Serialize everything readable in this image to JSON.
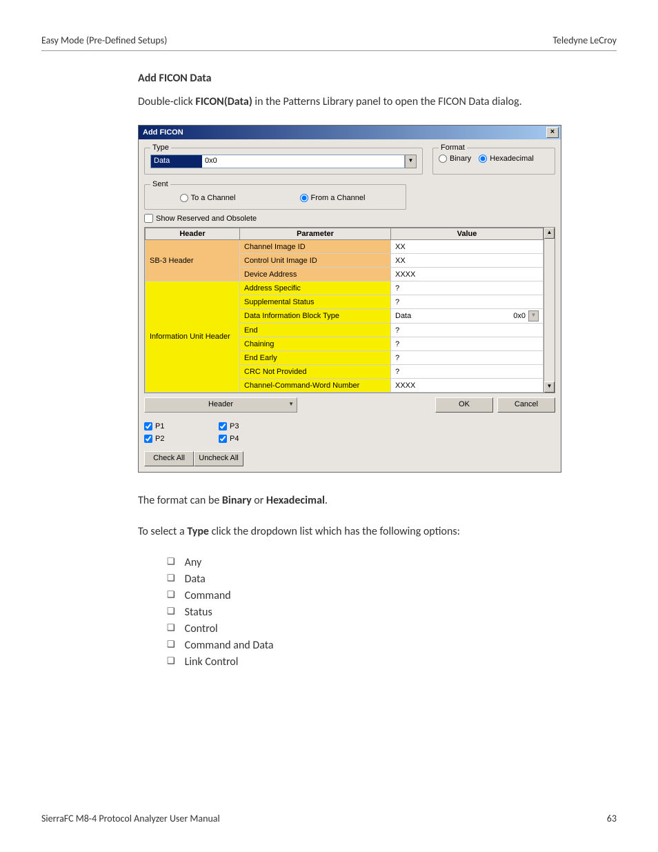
{
  "doc": {
    "header_left": "Easy Mode (Pre-Defined Setups)",
    "header_right": "Teledyne  LeCroy",
    "footer_left": "SierraFC M8-4 Protocol Analyzer User Manual",
    "footer_right": "63"
  },
  "section": {
    "heading": "Add FICON Data",
    "intro_pre": "Double-click ",
    "intro_bold": "FICON(Data)",
    "intro_post": " in the Patterns Library panel to open the FICON Data dialog.",
    "format_line_a": "The format can be ",
    "format_line_b": "Binary",
    "format_line_c": " or ",
    "format_line_d": "Hexadecimal",
    "format_line_e": ".",
    "type_line_a": "To select a ",
    "type_line_b": "Type",
    "type_line_c": " click the dropdown list which has the following options:",
    "options": [
      "Any",
      "Data",
      "Command",
      "Status",
      "Control",
      "Command and Data",
      "Link Control"
    ]
  },
  "dialog": {
    "title": "Add FICON",
    "type_legend": "Type",
    "type_value": "Data",
    "type_code": "0x0",
    "format_legend": "Format",
    "format_binary": "Binary",
    "format_hex": "Hexadecimal",
    "sent_legend": "Sent",
    "sent_to": "To a Channel",
    "sent_from": "From a Channel",
    "show_reserved": "Show Reserved and Obsolete",
    "col_header": "Header",
    "col_param": "Parameter",
    "col_value": "Value",
    "rows": {
      "g1": "SB-3 Header",
      "g2": "Information Unit Header",
      "r0p": "Channel Image ID",
      "r0v": "XX",
      "r1p": "Control Unit Image ID",
      "r1v": "XX",
      "r2p": "Device Address",
      "r2v": "XXXX",
      "r3p": "Address Specific",
      "r3v": "?",
      "r4p": "Supplemental Status",
      "r4v": "?",
      "r5p": "Data Information Block Type",
      "r5v_a": "Data",
      "r5v_b": "0x0",
      "r6p": "End",
      "r6v": "?",
      "r7p": "Chaining",
      "r7v": "?",
      "r8p": "End Early",
      "r8v": "?",
      "r9p": "CRC Not Provided",
      "r9v": "?",
      "r10p": "Channel-Command-Word Number",
      "r10v": "XXXX"
    },
    "header_dd": "Header",
    "ok": "OK",
    "cancel": "Cancel",
    "p1": "P1",
    "p2": "P2",
    "p3": "P3",
    "p4": "P4",
    "check_all": "Check All",
    "uncheck_all": "Uncheck All"
  }
}
